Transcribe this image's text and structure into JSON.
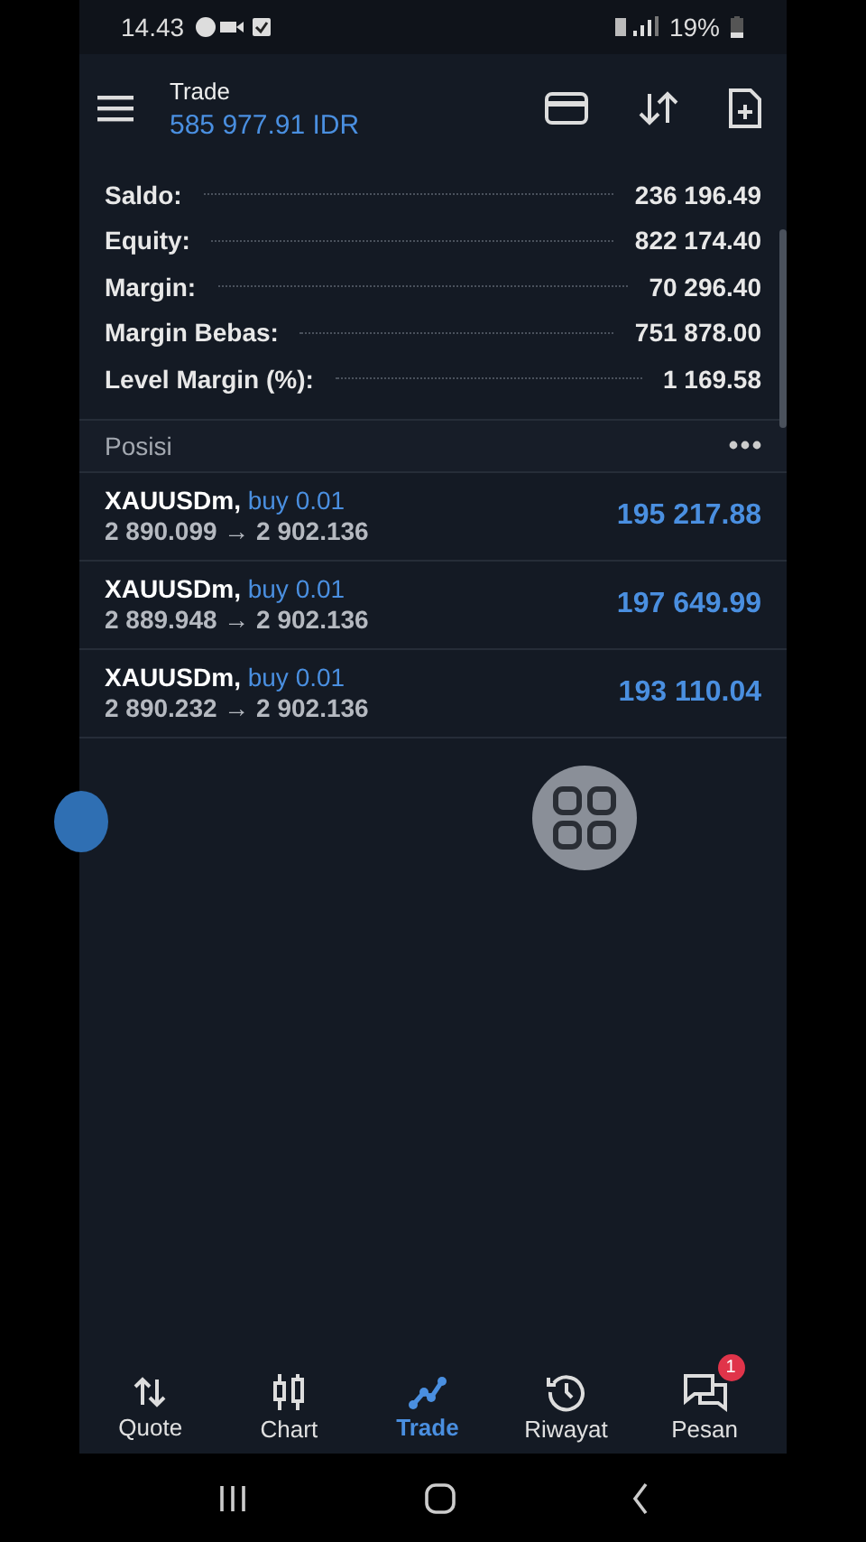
{
  "status_bar": {
    "time": "14.43",
    "battery": "19%"
  },
  "header": {
    "title": "Trade",
    "balance": "585 977.91 IDR"
  },
  "summary": [
    {
      "label": "Saldo:",
      "value": "236 196.49"
    },
    {
      "label": "Equity:",
      "value": "822 174.40"
    },
    {
      "label": "Margin:",
      "value": "70 296.40"
    },
    {
      "label": "Margin Bebas:",
      "value": "751 878.00"
    },
    {
      "label": "Level Margin (%):",
      "value": "1 169.58"
    }
  ],
  "positions": {
    "title": "Posisi",
    "items": [
      {
        "symbol": "XAUUSDm,",
        "side": "buy 0.01",
        "prices": "2 890.099 → 2 902.136",
        "profit": "195 217.88"
      },
      {
        "symbol": "XAUUSDm,",
        "side": "buy 0.01",
        "prices": "2 889.948 → 2 902.136",
        "profit": "197 649.99"
      },
      {
        "symbol": "XAUUSDm,",
        "side": "buy 0.01",
        "prices": "2 890.232 → 2 902.136",
        "profit": "193 110.04"
      }
    ]
  },
  "bottom_nav": [
    {
      "kind": "quote",
      "label": "Quote",
      "selected": false
    },
    {
      "kind": "chart",
      "label": "Chart",
      "selected": false
    },
    {
      "kind": "trade",
      "label": "Trade",
      "selected": true
    },
    {
      "kind": "history",
      "label": "Riwayat",
      "selected": false
    },
    {
      "kind": "messages",
      "label": "Pesan",
      "selected": false,
      "badge": "1"
    }
  ]
}
